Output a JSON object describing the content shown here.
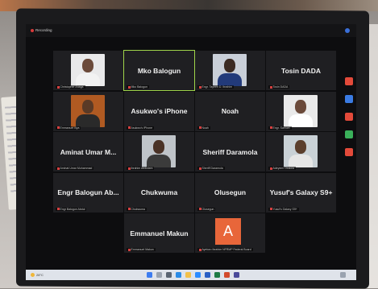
{
  "window": {
    "recording_label": "Recording"
  },
  "participants": [
    {
      "name_big": "",
      "label": "Christopher Anaga",
      "photo": true,
      "skin": "#6b4a3a",
      "bg": "#e9e9ea",
      "shirt": "#f2f2f2"
    },
    {
      "name_big": "Mko Balogun",
      "label": "Mko Balogun",
      "photo": false,
      "active": true
    },
    {
      "name_big": "",
      "label": "Engr. Tayeen D. Ibrahim",
      "photo": true,
      "skin": "#3b2a22",
      "bg": "#c9cfd8",
      "shirt": "#223a7a"
    },
    {
      "name_big": "Tosin DADA",
      "label": "Tosin DADA",
      "photo": false
    },
    {
      "name_big": "",
      "label": "Emmanuel Iliya",
      "photo": true,
      "skin": "#5a3a26",
      "bg": "#b05a22",
      "shirt": "#2a2a2a"
    },
    {
      "name_big": "Asukwo's iPhone",
      "label": "Asukwo's iPhone",
      "photo": false
    },
    {
      "name_big": "Noah",
      "label": "Noah",
      "photo": false
    },
    {
      "name_big": "",
      "label": "Engr. Samuel",
      "photo": true,
      "skin": "#6b4a3a",
      "bg": "#eaeaea",
      "shirt": "#ffffff"
    },
    {
      "name_big": "Aminat Umar M...",
      "label": "Aminat Umar Muhammad",
      "photo": false
    },
    {
      "name_big": "",
      "label": "Ibrahim Abdullahi",
      "photo": true,
      "skin": "#4a3226",
      "bg": "#bfc4c9",
      "shirt": "#3b3b3b"
    },
    {
      "name_big": "Sheriff Daramola",
      "label": "Sheriff Daramola",
      "photo": false
    },
    {
      "name_big": "",
      "label": "Adeyemi Olusola",
      "photo": true,
      "skin": "#5b3e2c",
      "bg": "#c9d1d6",
      "shirt": "#e6e6e6"
    },
    {
      "name_big": "Engr Balogun Ab...",
      "label": "Engr Balogun Abdul",
      "photo": false
    },
    {
      "name_big": "Chukwuma",
      "label": "Chukwuma",
      "photo": false
    },
    {
      "name_big": "Olusegun",
      "label": "Olusegun",
      "photo": false
    },
    {
      "name_big": "Yusuf's Galaxy S9+",
      "label": "Yusuf's Galaxy S9+",
      "photo": false
    },
    {
      "name_big": "Emmanuel Makun",
      "label": "Emmanuel Makun",
      "photo": false
    },
    {
      "name_big": "A",
      "label": "Ayetoro Ibrahim NFRMP Federal Board",
      "photo": false,
      "avatar": true
    }
  ],
  "taskbar": {
    "weather": "28°C"
  },
  "colors": {
    "active_border": "#9fd44a",
    "avatar_bg": "#e8663a",
    "mic_muted": "#d64040"
  }
}
